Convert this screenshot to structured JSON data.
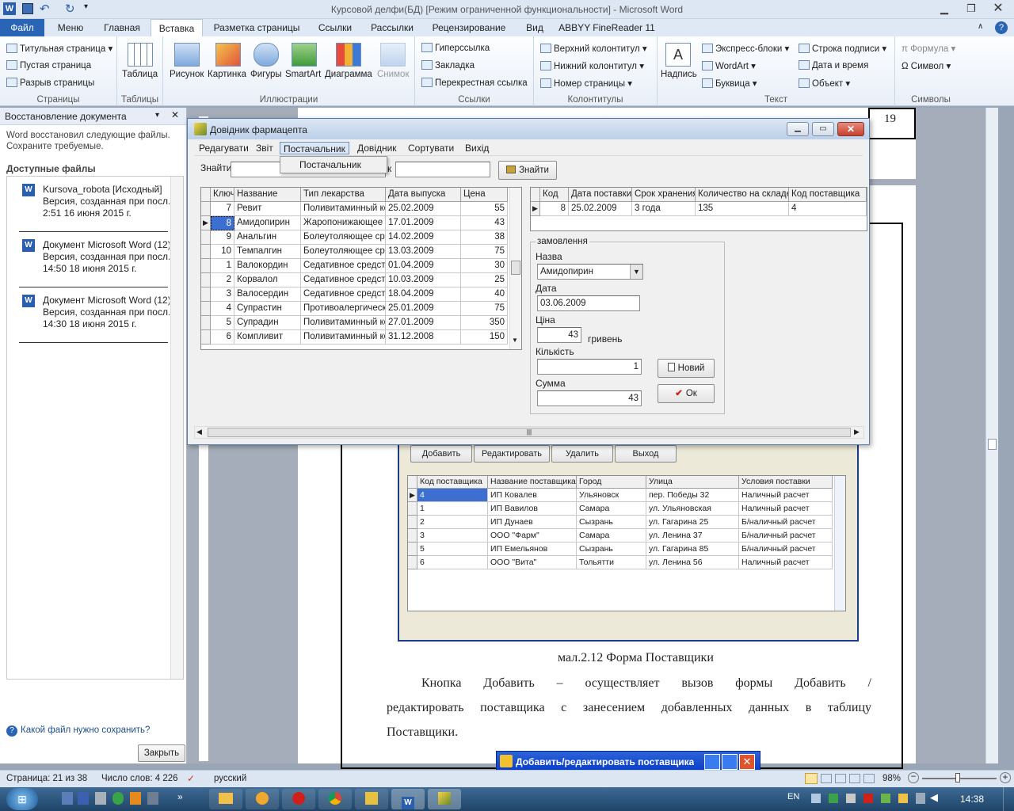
{
  "window": {
    "title": "Курсовой делфи(БД) [Режим ограниченной функциональности]  -  Microsoft Word"
  },
  "tabs": [
    "Файл",
    "Меню",
    "Главная",
    "Вставка",
    "Разметка страницы",
    "Ссылки",
    "Рассылки",
    "Рецензирование",
    "Вид",
    "ABBYY FineReader 11"
  ],
  "ribbon": {
    "pages": {
      "label": "Страницы",
      "items": [
        "Титульная страница",
        "Пустая страница",
        "Разрыв страницы"
      ]
    },
    "tables": {
      "label": "Таблицы",
      "items": [
        "Таблица"
      ]
    },
    "illustrations": {
      "label": "Иллюстрации",
      "items": [
        "Рисунок",
        "Картинка",
        "Фигуры",
        "SmartArt",
        "Диаграмма",
        "Снимок"
      ]
    },
    "links": {
      "label": "Ссылки",
      "items": [
        "Гиперссылка",
        "Закладка",
        "Перекрестная ссылка"
      ]
    },
    "headers": {
      "label": "Колонтитулы",
      "items": [
        "Верхний колонтитул",
        "Нижний колонтитул",
        "Номер страницы"
      ]
    },
    "text": {
      "label": "Текст",
      "big": "Надпись",
      "items": [
        "Экспресс-блоки",
        "WordArt",
        "Буквица",
        "Строка подписи",
        "Дата и время",
        "Объект"
      ]
    },
    "symbols": {
      "label": "Символы",
      "items": [
        "Формула",
        "Символ"
      ]
    }
  },
  "recovery": {
    "title": "Восстановление документа",
    "message": "Word восстановил следующие файлы. Сохраните требуемые.",
    "available": "Доступные файлы",
    "files": [
      {
        "name": "Kursova_robota  [Исходный]",
        "version": "Версия, созданная при посл...",
        "time": "2:51 16 июня 2015 г."
      },
      {
        "name": "Документ Microsoft Word (12) ...",
        "version": "Версия, созданная при посл...",
        "time": "14:50 18 июня 2015 г."
      },
      {
        "name": "Документ Microsoft Word (12) ...",
        "version": "Версия, созданная при посл...",
        "time": "14:30 18 июня 2015 г."
      }
    ],
    "help": "Какой файл нужно сохранить?",
    "close": "Закрыть"
  },
  "document": {
    "page_number": "19",
    "suppliers_buttons": [
      "Добавить",
      "Редактировать",
      "Удалить",
      "Выход"
    ],
    "suppliers_headers": [
      "Код поставщика",
      "Название поставщика",
      "Город",
      "Улица",
      "Условия поставки"
    ],
    "suppliers_rows": [
      [
        "4",
        "ИП Ковалев",
        "Ульяновск",
        "пер. Победы 32",
        "Наличный расчет"
      ],
      [
        "1",
        "ИП Вавилов",
        "Самара",
        "ул. Ульяновская",
        "Наличный расчет"
      ],
      [
        "2",
        "ИП Дунаев",
        "Сызрань",
        "ул. Гагарина 25",
        "Б/наличный расчет"
      ],
      [
        "3",
        "ООО \"Фарм\"",
        "Самара",
        "ул. Ленина 37",
        "Б/наличный расчет"
      ],
      [
        "5",
        "ИП Емельянов",
        "Сызрань",
        "ул. Гагарина 85",
        "Б/наличный расчет"
      ],
      [
        "6",
        "ООО \"Вита\"",
        "Тольятти",
        " ул. Ленина 56",
        "Наличный расчет"
      ]
    ],
    "caption": "мал.2.12 Форма Поставщики",
    "para1": "Кнопка Добавить – осуществляет вызов формы Добавить /",
    "para2": "редактировать поставщика с занесением добавленных данных в таблицу",
    "para3": "Поставщики.",
    "sub_window_title": "Добавить/редактировать поставщика"
  },
  "dialog": {
    "title": "Довідник фармацепта",
    "menu": [
      "Редагувати",
      "Звіт",
      "Постачальник",
      "Довідник",
      "Сортувати",
      "Вихід"
    ],
    "dropdown_item": "Постачальник",
    "search_label": "Знайти",
    "search_label2": "к",
    "search_button": "Знайти",
    "med_headers": [
      "Ключ",
      "Название",
      "Тип лекарства",
      "Дата выпуска",
      "Цена"
    ],
    "med_rows": [
      [
        "7",
        "Ревит",
        "Поливитаминный ко",
        "25.02.2009",
        "55"
      ],
      [
        "8",
        "Амидопирин",
        "Жаропонижающее с",
        "17.01.2009",
        "43"
      ],
      [
        "9",
        "Анальгин",
        "Болеутоляющее сре",
        "14.02.2009",
        "38"
      ],
      [
        "10",
        "Темпалгин",
        "Болеутоляющее сре",
        "13.03.2009",
        "75"
      ],
      [
        "1",
        "Валокордин",
        "Седативное средств",
        "01.04.2009",
        "30"
      ],
      [
        "2",
        "Корвалол",
        "Седативное средств",
        "10.03.2009",
        "25"
      ],
      [
        "3",
        "Валосердин",
        "Седативное средств",
        "18.04.2009",
        "40"
      ],
      [
        "4",
        "Супрастин",
        "Противоалергическо",
        "25.01.2009",
        "75"
      ],
      [
        "5",
        "Супрадин",
        "Поливитаминный ко",
        "27.01.2009",
        "350"
      ],
      [
        "6",
        "Компливит",
        "Поливитаминный ко",
        "31.12.2008",
        "150"
      ]
    ],
    "stock_headers": [
      "Код",
      "Дата поставки",
      "Срок хранения",
      "Количество на складе",
      "Код поставщика"
    ],
    "stock_row": [
      "8",
      "25.02.2009",
      "3 года",
      "135",
      "4"
    ],
    "order": {
      "group": "замовлення",
      "name_label": "Назва",
      "name_value": "Амидопирин",
      "date_label": "Дата",
      "date_value": "03.06.2009",
      "price_label": "Ціна",
      "price_value": "43",
      "price_unit": "гривень",
      "qty_label": "Кількість",
      "qty_value": "1",
      "sum_label": "Сумма",
      "sum_value": "43",
      "new_button": "Новий",
      "ok_button": "Ок"
    }
  },
  "status": {
    "page": "Страница: 21 из 38",
    "words": "Число слов: 4 226",
    "lang": "русский",
    "zoom": "98%"
  },
  "taskbar": {
    "lang": "EN",
    "time": "14:38"
  }
}
